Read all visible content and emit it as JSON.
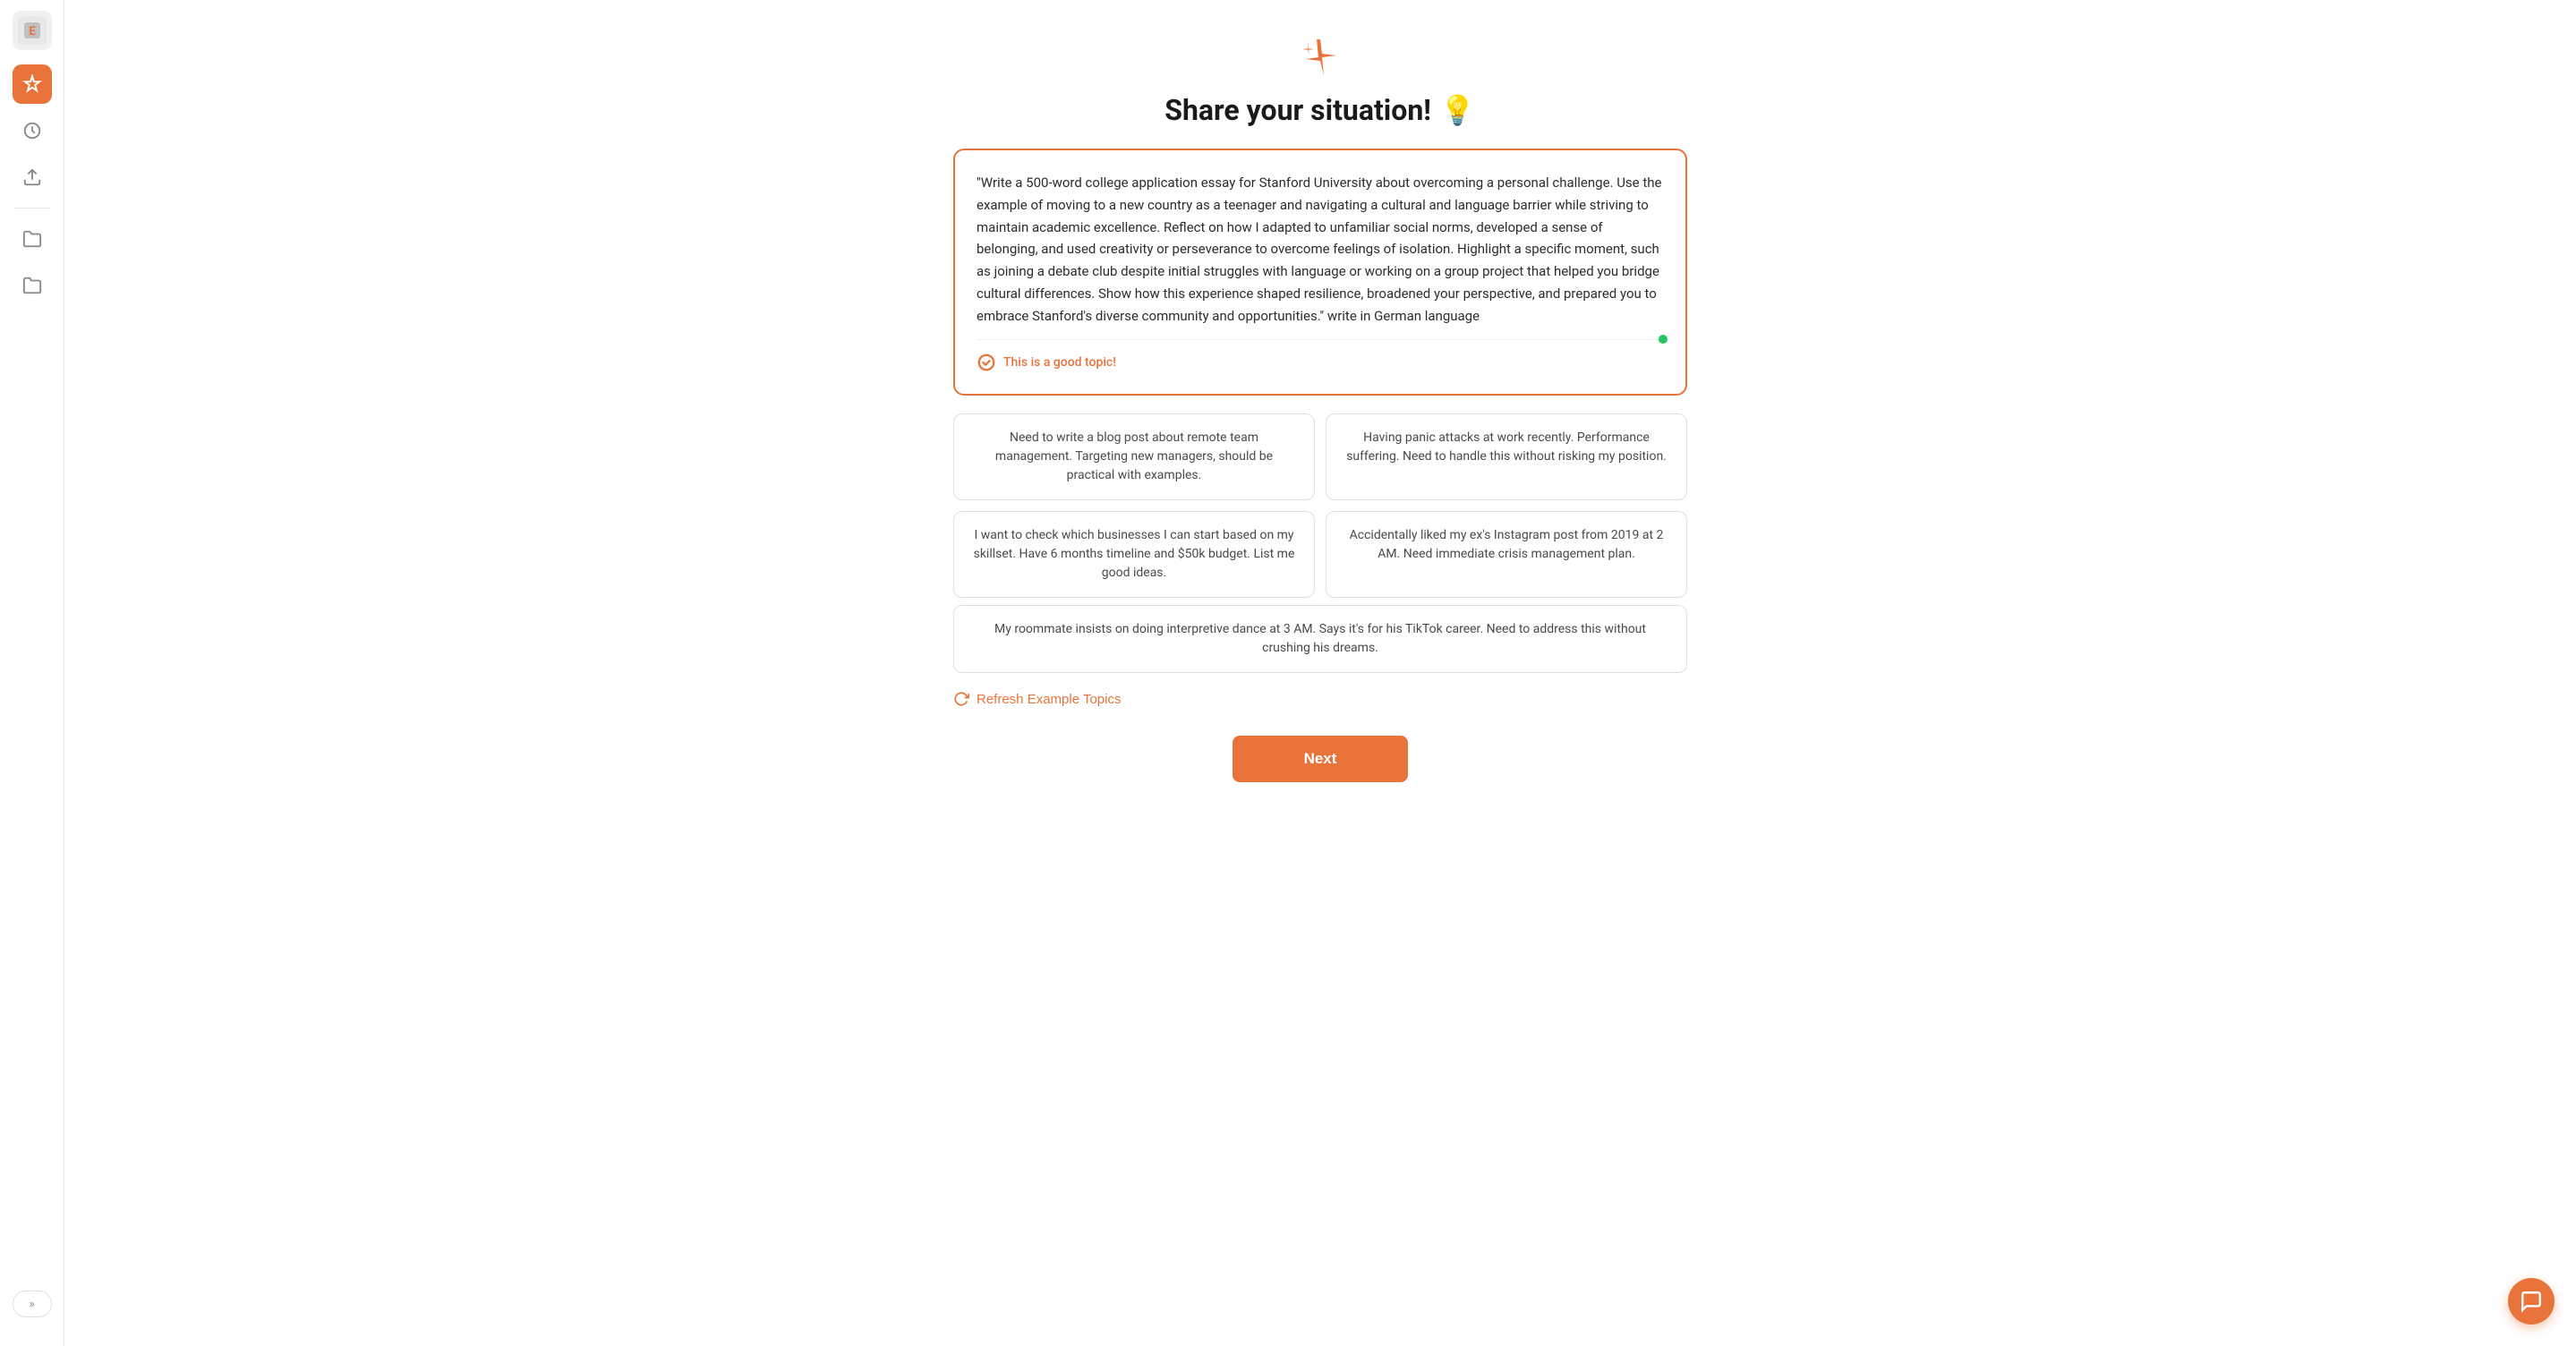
{
  "sidebar": {
    "logo_text": "E",
    "collapse_label": "»",
    "items": [
      {
        "name": "ai-button",
        "label": "AI",
        "active": true
      },
      {
        "name": "history-button",
        "label": "History",
        "active": false
      },
      {
        "name": "export-button",
        "label": "Export",
        "active": false
      },
      {
        "name": "folder1-button",
        "label": "Folder",
        "active": false
      },
      {
        "name": "folder2-button",
        "label": "Folder 2",
        "active": false
      }
    ]
  },
  "page": {
    "title": "Share your situation!",
    "title_emoji": "💡",
    "situation_text": "\"Write a 500-word college application essay for Stanford University about overcoming a personal challenge. Use the example of moving to a new country as a teenager and navigating a cultural and language barrier while striving to maintain academic excellence. Reflect on how I adapted to unfamiliar social norms, developed a sense of belonging, and used creativity or perseverance to overcome feelings of isolation. Highlight a specific moment, such as joining a debate club despite initial struggles with language or working on a group project that helped you bridge cultural differences. Show how this experience shaped resilience, broadened your perspective, and prepared you to embrace Stanford's diverse community and opportunities.\" write in German language",
    "good_topic_label": "This is a good topic!",
    "example_topics": [
      {
        "id": "topic1",
        "text": "Need to write a blog post about remote team management. Targeting new managers, should be practical with examples.",
        "wide": false
      },
      {
        "id": "topic2",
        "text": "Having panic attacks at work recently. Performance suffering. Need to handle this without risking my position.",
        "wide": false
      },
      {
        "id": "topic3",
        "text": "I want to check which businesses I can start based on my skillset. Have 6 months timeline and $50k budget. List me good ideas.",
        "wide": false
      },
      {
        "id": "topic4",
        "text": "Accidentally liked my ex's Instagram post from 2019 at 2 AM. Need immediate crisis management plan.",
        "wide": false
      },
      {
        "id": "topic5",
        "text": "My roommate insists on doing interpretive dance at 3 AM. Says it's for his TikTok career. Need to address this without crushing his dreams.",
        "wide": true
      }
    ],
    "refresh_label": "Refresh Example Topics",
    "next_label": "Next"
  }
}
